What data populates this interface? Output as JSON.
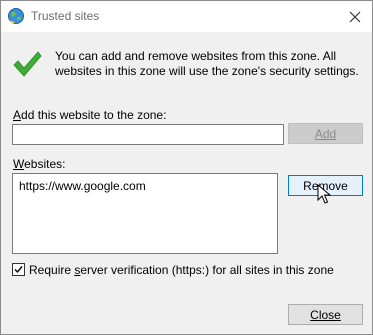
{
  "window": {
    "title": "Trusted sites"
  },
  "info": {
    "text": "You can add and remove websites from this zone. All websites in this zone will use the zone's security settings."
  },
  "add_website": {
    "label_prefix": "",
    "label_accel": "A",
    "label_rest": "dd this website to the zone:",
    "value": "",
    "button_label": "Add"
  },
  "websites": {
    "label_accel": "W",
    "label_rest": "ebsites:",
    "items": [
      "https://www.google.com"
    ],
    "remove_label": "Remove"
  },
  "verification": {
    "checked": true,
    "label_before": "Require ",
    "label_accel": "s",
    "label_after": "erver verification (https:) for all sites in this zone"
  },
  "close_button": {
    "label": "Close"
  },
  "colors": {
    "accent": "#0078d7",
    "check_green": "#3dad35"
  }
}
